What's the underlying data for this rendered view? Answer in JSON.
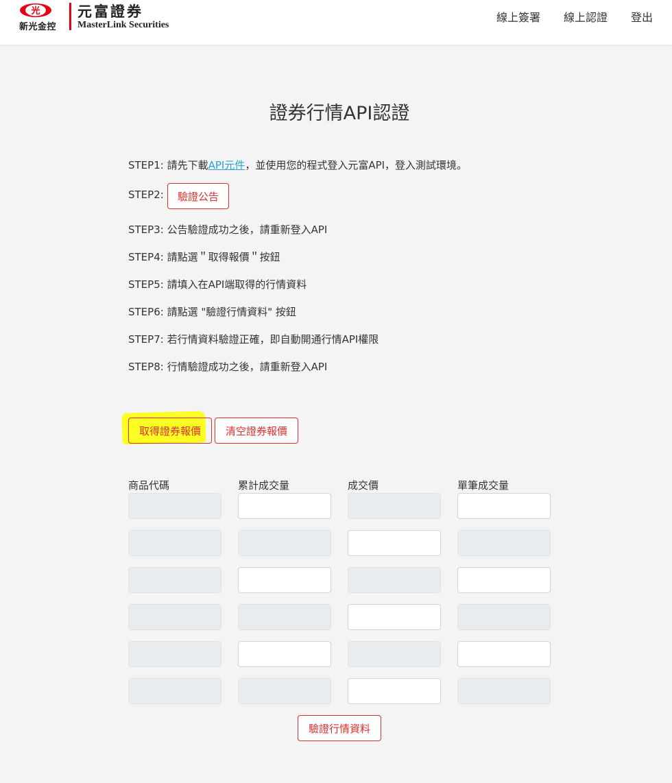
{
  "header": {
    "logo_sub": "新光金控",
    "logo_mark_text": "光",
    "logo_cn": "元富證券",
    "logo_en": "MasterLink Securities",
    "nav": [
      "線上簽署",
      "線上認證",
      "登出"
    ]
  },
  "title": "證券行情API認證",
  "steps": {
    "s1_prefix": "STEP1: 請先下載",
    "s1_link": "API元件",
    "s1_suffix": "，並使用您的程式登入元富API，登入測試環境。",
    "s2_prefix": "STEP2:",
    "s2_button": "驗證公告",
    "s3": "STEP3: 公告驗證成功之後，請重新登入API",
    "s4": "STEP4: 請點選＂取得報價＂按鈕",
    "s5": "STEP5: 請填入在API端取得的行情資料",
    "s6": "STEP6: 請點選 \"驗證行情資料\" 按鈕",
    "s7": "STEP7: 若行情資料驗證正確，即自動開通行情API權限",
    "s8": "STEP8: 行情驗證成功之後，請重新登入API"
  },
  "actions": {
    "get_quote": "取得證券報價",
    "clear_quote": "清空證券報價",
    "verify": "驗證行情資料"
  },
  "table": {
    "headers": [
      "商品代碼",
      "累計成交量",
      "成交價",
      "單筆成交量"
    ]
  },
  "colors": {
    "brand_red": "#d9302c",
    "link_blue": "#29a3d6",
    "highlight": "#ffff00"
  }
}
